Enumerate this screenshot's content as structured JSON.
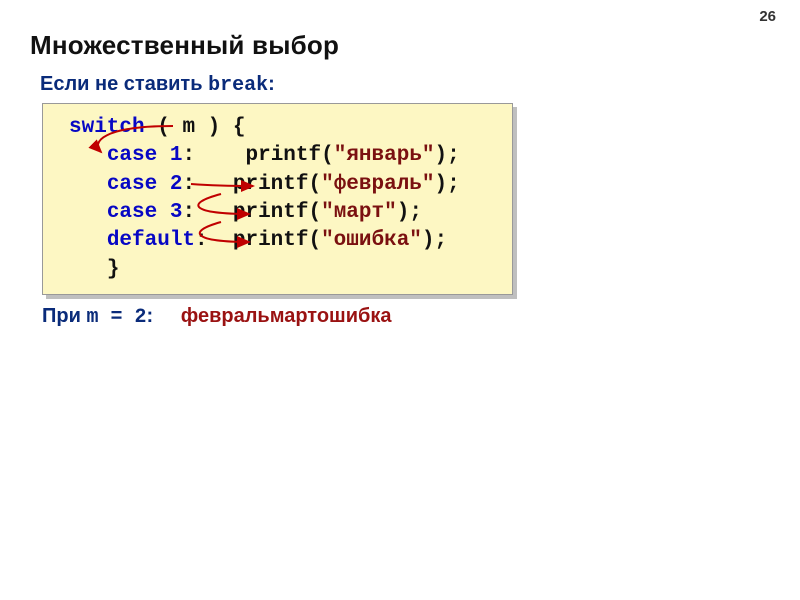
{
  "pageNumber": "26",
  "title": "Множественный выбор",
  "subtitle": {
    "prefix": "Если не ставить ",
    "keyword": "break",
    "suffix": ":"
  },
  "code": {
    "line1": {
      "kw": "switch",
      "open": " ( ",
      "var": "m",
      "close": " ) {"
    },
    "line2": {
      "indent": "   ",
      "kw": "case",
      "sp1": " ",
      "num": "1",
      "colon": ":",
      "gap": "    ",
      "fn": "printf(",
      "str": "\"январь\"",
      "end": ");"
    },
    "line3": {
      "indent": "   ",
      "kw": "case",
      "sp1": " ",
      "num": "2",
      "colon": ":",
      "gap": "   ",
      "fn": "printf(",
      "str": "\"февраль\"",
      "end": ");"
    },
    "line4": {
      "indent": "   ",
      "kw": "case",
      "sp1": " ",
      "num": "3",
      "colon": ":",
      "gap": "   ",
      "fn": "printf(",
      "str": "\"март\"",
      "end": ");"
    },
    "line5": {
      "indent": "   ",
      "kw": "default",
      "colon": ":",
      "gap": "  ",
      "fn": "printf(",
      "str": "\"ошибка\"",
      "end": ");"
    },
    "line6": {
      "indent": "   ",
      "close": "}"
    }
  },
  "footer": {
    "prefix": "При ",
    "var": "m = 2",
    "suffix": ":",
    "result": "февральмартошибка"
  },
  "arrows": {
    "color": "#c00000"
  }
}
